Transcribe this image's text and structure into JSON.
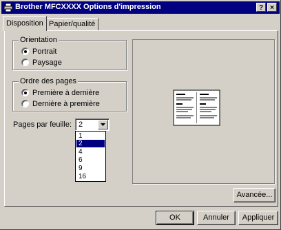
{
  "window": {
    "title": "Brother MFCXXXX Options d'impression",
    "help_button": "?",
    "close_button": "×"
  },
  "tabs": [
    {
      "label": "Disposition",
      "active": true
    },
    {
      "label": "Papier/qualité",
      "active": false
    }
  ],
  "orientation": {
    "legend": "Orientation",
    "options": [
      {
        "label": "Portrait",
        "selected": true
      },
      {
        "label": "Paysage",
        "selected": false
      }
    ]
  },
  "page_order": {
    "legend": "Ordre des pages",
    "options": [
      {
        "label": "Première à dernière",
        "selected": true
      },
      {
        "label": "Dernière à première",
        "selected": false
      }
    ]
  },
  "pages_per_sheet": {
    "label": "Pages par feuille:",
    "value": "2",
    "options": [
      "1",
      "2",
      "4",
      "6",
      "9",
      "16"
    ],
    "highlighted": "2"
  },
  "buttons": {
    "advanced": "Avancée...",
    "ok": "OK",
    "cancel": "Annuler",
    "apply": "Appliquer"
  },
  "colors": {
    "titlebar": "#000080",
    "face": "#d4d0c8",
    "selection": "#000080"
  }
}
